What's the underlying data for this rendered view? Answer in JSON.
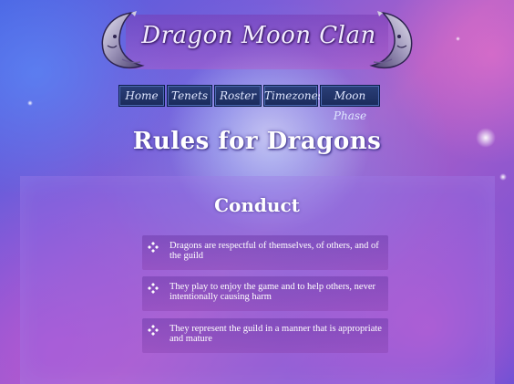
{
  "header": {
    "site_title": "Dragon Moon Clan"
  },
  "nav": {
    "items": [
      {
        "label": "Home"
      },
      {
        "label": "Tenets"
      },
      {
        "label": "Roster"
      },
      {
        "label": "Timezones"
      },
      {
        "label": "Moon Phase"
      }
    ]
  },
  "page": {
    "title": "Rules for Dragons"
  },
  "content": {
    "section_title": "Conduct",
    "rules": [
      {
        "text": "Dragons are respectful of themselves, of others, and of the guild"
      },
      {
        "text": "They play to enjoy the game and to help others, never intentionally causing harm"
      },
      {
        "text": "They represent the guild in a manner that is appropriate and mature"
      }
    ]
  },
  "icons": {
    "banner_left": "crescent-moon-face-icon",
    "banner_right": "crescent-moon-face-icon",
    "bullet": "four-diamond-bullet-icon"
  },
  "colors": {
    "nav_button_bg": "#1b2b5c",
    "nav_button_text": "#dfe6ff",
    "rule_band": "#7a46b0",
    "text": "#ffffff"
  }
}
